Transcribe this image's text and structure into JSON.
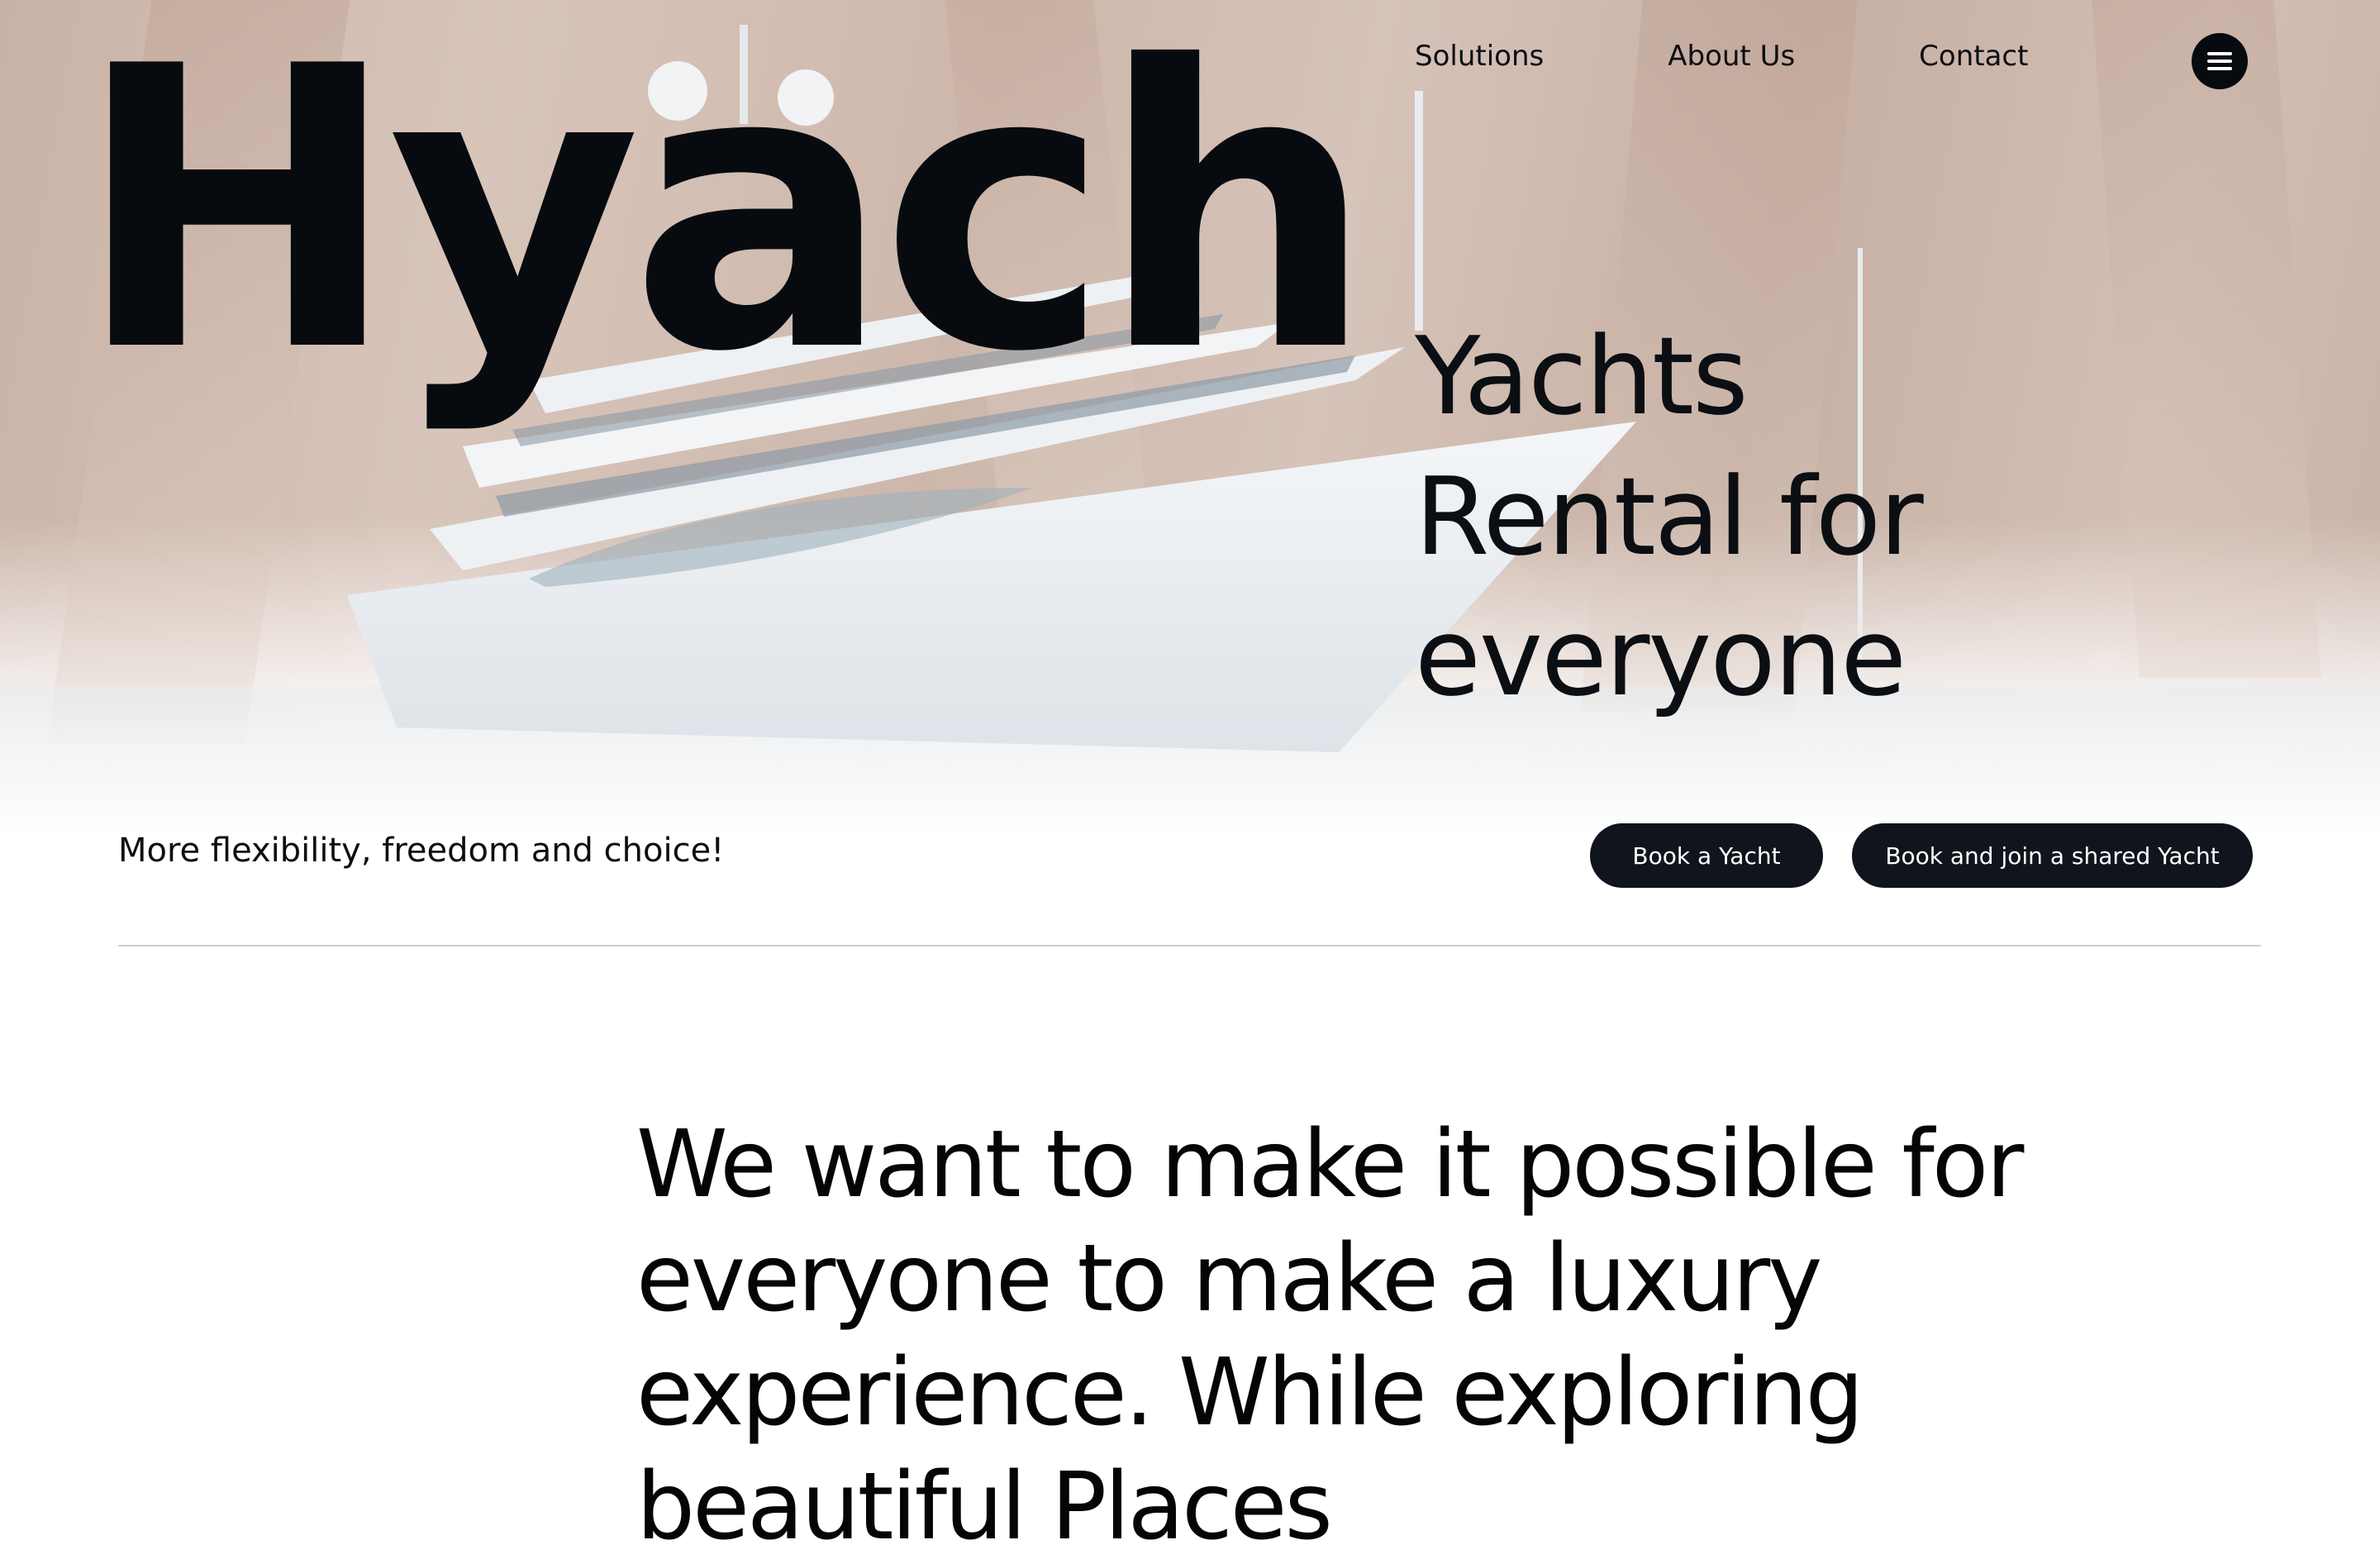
{
  "brand": {
    "logo_text": "Hyach"
  },
  "nav": {
    "items": [
      {
        "label": "Solutions"
      },
      {
        "label": "About Us"
      },
      {
        "label": "Contact"
      }
    ],
    "menu_icon": "hamburger-menu-icon"
  },
  "hero": {
    "title_lines": [
      "Yachts",
      "Rental for",
      "everyone"
    ],
    "tagline": "More flexibility, freedom and choice!",
    "buttons": {
      "book": "Book a Yacht",
      "shared": "Book and join a shared Yacht"
    },
    "background": "yacht-cliff-photo"
  },
  "mission": {
    "text": "We want to make it possible for everyone to make a luxury experience. While exploring beautiful Places"
  },
  "colors": {
    "dark": "#0b0e12",
    "button_bg": "#10141c",
    "button_text": "#ffffff",
    "divider": "#cfcfcf"
  }
}
